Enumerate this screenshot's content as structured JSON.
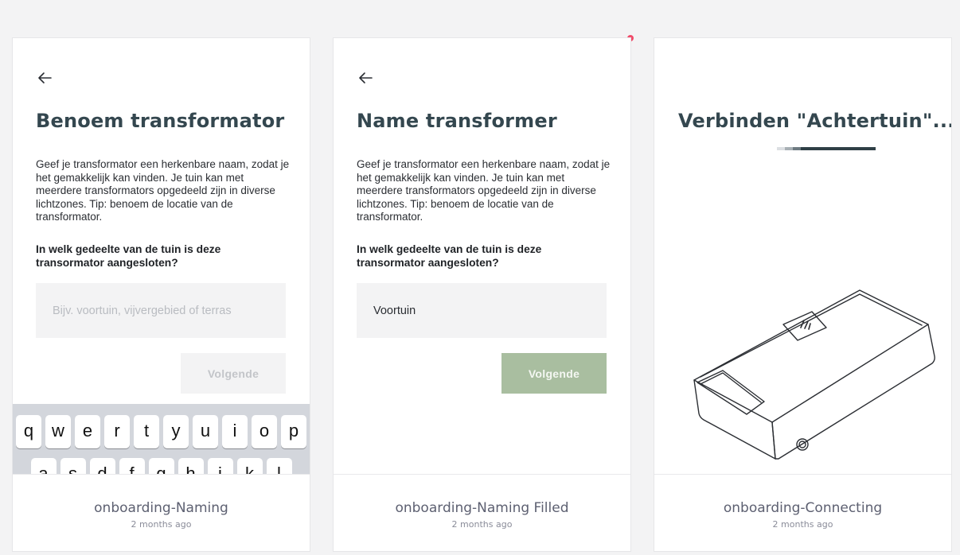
{
  "colors": {
    "title": "#34474f",
    "button_enabled": "#a9bea0",
    "button_disabled_bg": "#f3f3f4",
    "indicator_dot": "#f04c6a"
  },
  "cards": [
    {
      "back_icon": "arrow-left-icon",
      "title": "Benoem transformator",
      "description": "Geef je transformator een herkenbare naam, zodat je het gemakkelijk kan vinden. Je tuin kan met meerdere transformators opgedeeld zijn in diverse lichtzones. Tip: benoem de locatie van de transformator.",
      "question": "In welk gedeelte van de tuin is deze transormator aangesloten?",
      "input": {
        "value": "",
        "placeholder": "Bijv. voortuin, vijvergebied of terras"
      },
      "button_label": "Volgende",
      "keyboard": {
        "row1": [
          "q",
          "w",
          "e",
          "r",
          "t",
          "y",
          "u",
          "i",
          "o",
          "p"
        ],
        "row2": [
          "a",
          "s",
          "d",
          "f",
          "g",
          "h",
          "j",
          "k",
          "l"
        ]
      },
      "footer": {
        "name": "onboarding-Naming",
        "time": "2 months ago"
      }
    },
    {
      "back_icon": "arrow-left-icon",
      "title": "Name transformer",
      "description": "Geef je transformator een herkenbare naam, zodat je het gemakkelijk kan vinden. Je tuin kan met meerdere transformators opgedeeld zijn in diverse lichtzones. Tip: benoem de locatie van de transformator.",
      "question": "In welk gedeelte van de tuin is deze transormator aangesloten?",
      "input": {
        "value": "Voortuin",
        "placeholder": ""
      },
      "button_label": "Volgende",
      "footer": {
        "name": "onboarding-Naming Filled",
        "time": "2 months ago"
      }
    },
    {
      "title": "Verbinden \"Achtertuin\"...",
      "progress_icon": "loading-progress-bar",
      "illustration": "transformer-box-illustration",
      "footer": {
        "name": "onboarding-Connecting",
        "time": "2 months ago"
      }
    }
  ]
}
